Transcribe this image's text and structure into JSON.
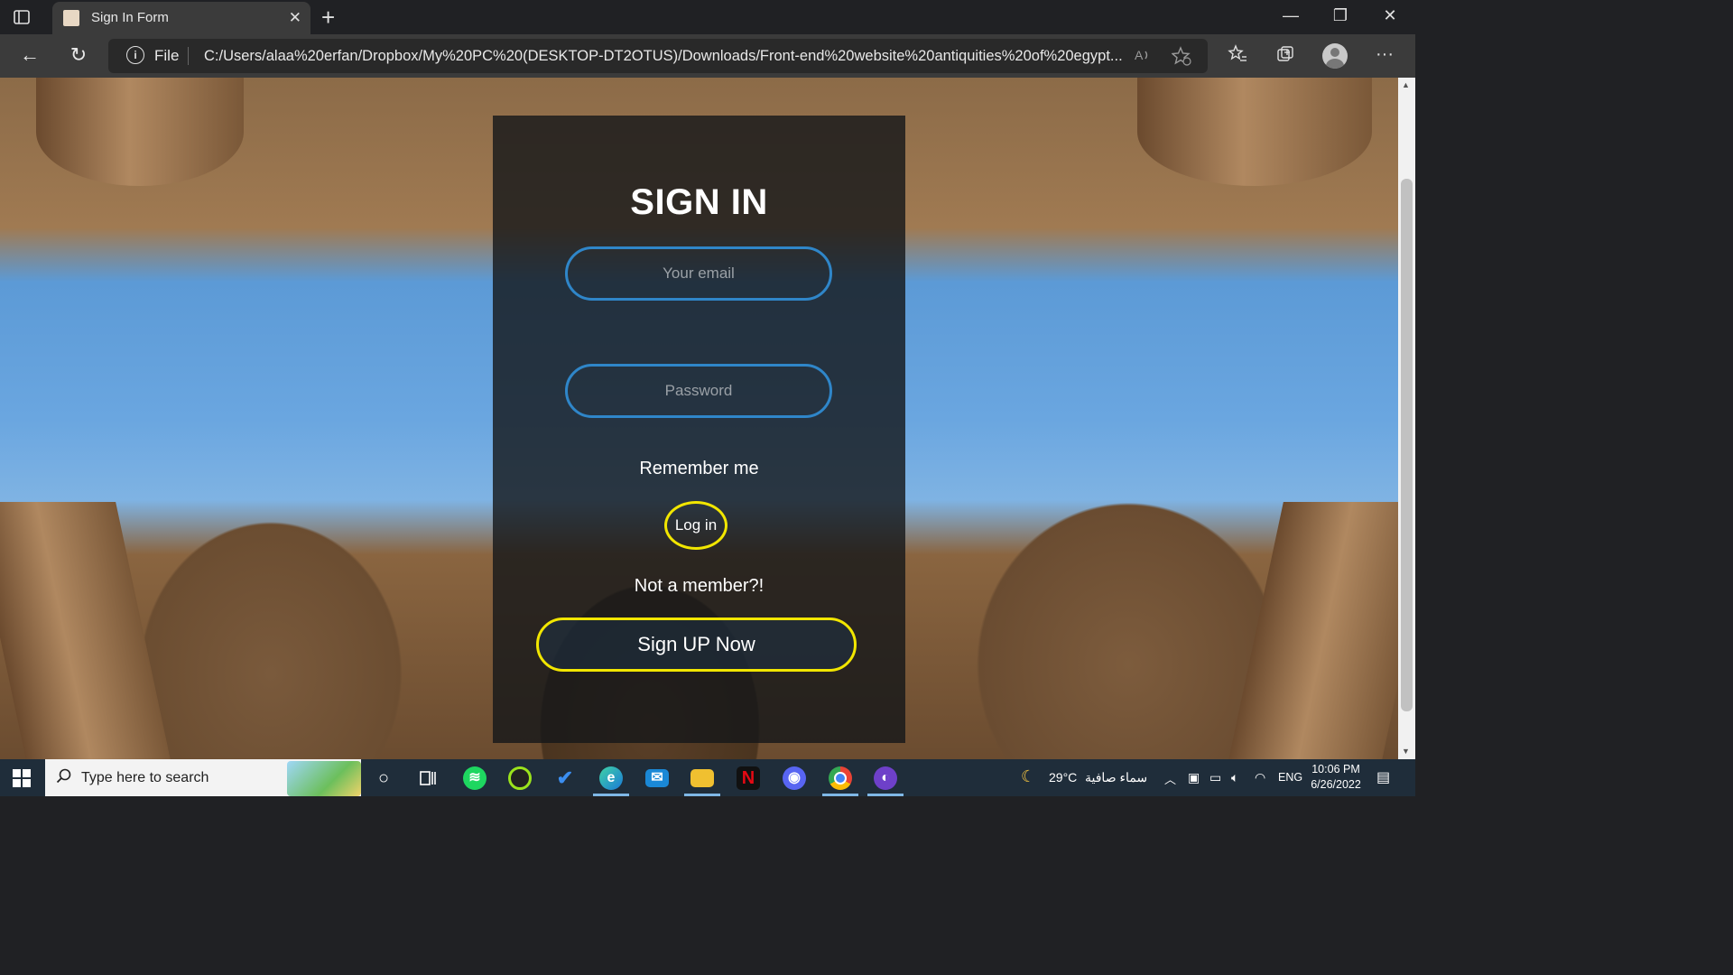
{
  "browser": {
    "tab_title": "Sign In Form",
    "new_tab_symbol": "+",
    "tab_close_symbol": "✕",
    "window_controls": {
      "minimize": "—",
      "restore": "❐",
      "close": "✕"
    },
    "nav": {
      "back": "←",
      "refresh": "↻",
      "more": "···"
    },
    "address": {
      "scheme_label": "File",
      "url": "C:/Users/alaa%20erfan/Dropbox/My%20PC%20(DESKTOP-DT2OTUS)/Downloads/Front-end%20website%20antiquities%20of%20egypt..."
    }
  },
  "form": {
    "heading": "SIGN IN",
    "email": {
      "placeholder": "Your email",
      "value": ""
    },
    "password": {
      "placeholder": "Password",
      "value": ""
    },
    "remember_label": "Remember me",
    "login_label": "Log in",
    "not_member_text": "Not a member?!",
    "signup_label": "Sign UP Now"
  },
  "taskbar": {
    "search_placeholder": "Type here to search",
    "pinned_apps": [
      "cortana",
      "task-view",
      "spotify",
      "app-ring",
      "todo",
      "edge",
      "mail",
      "file-explorer",
      "netflix",
      "discord",
      "chrome",
      "github-desktop"
    ],
    "weather": {
      "temp": "29°C",
      "condition": "سماء صافية"
    },
    "language": "ENG",
    "time": "10:06 PM",
    "date": "6/26/2022"
  },
  "colors": {
    "input_border": "#2f86c9",
    "button_border": "#f2e600",
    "card_bg": "rgba(20,22,25,0.80)"
  }
}
